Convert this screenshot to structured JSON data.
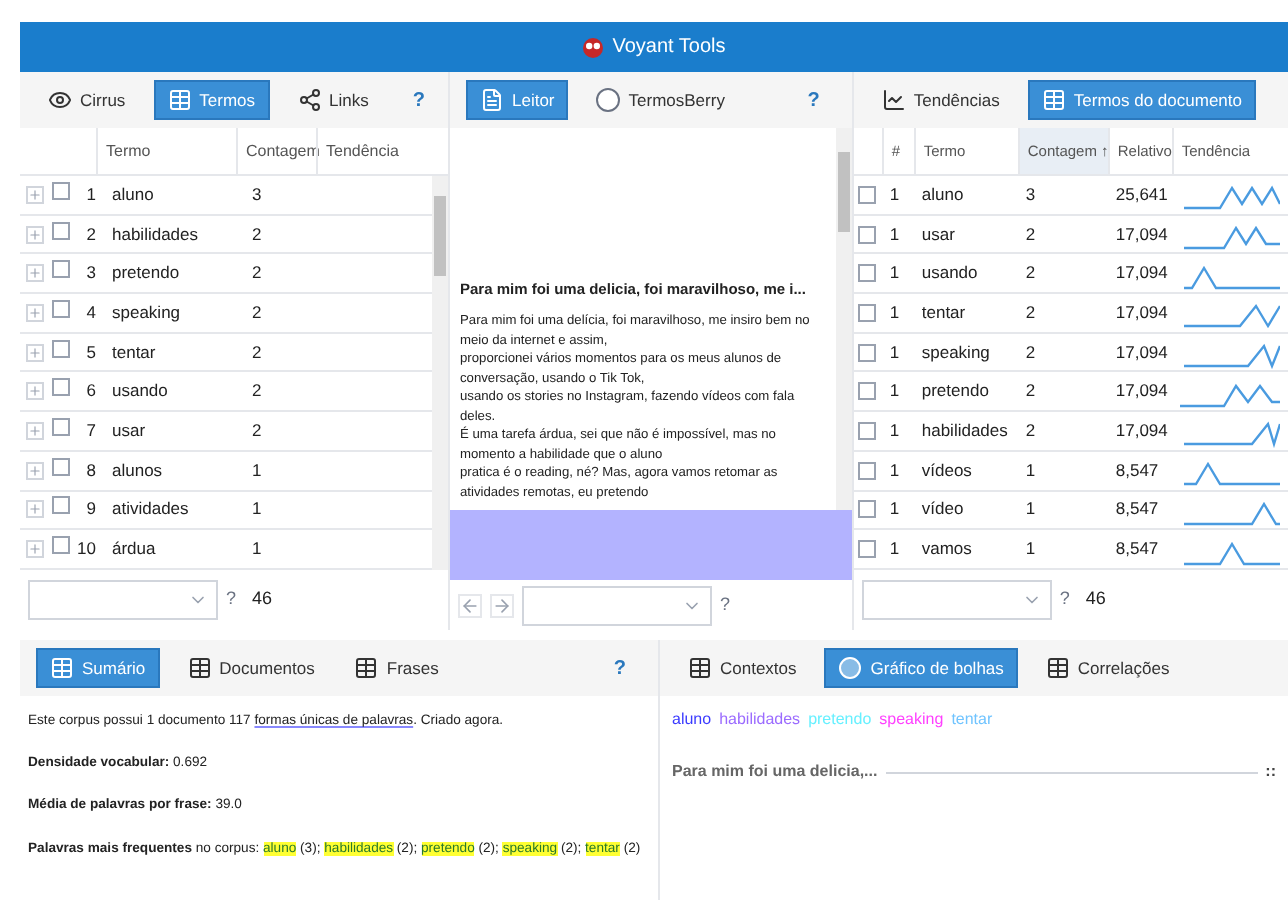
{
  "header": {
    "title": "Voyant Tools"
  },
  "terms_panel": {
    "tabs": [
      {
        "label": "Cirrus",
        "kind": "eye",
        "selected": false
      },
      {
        "label": "Termos",
        "kind": "table",
        "selected": true
      },
      {
        "label": "Links",
        "kind": "links",
        "selected": false
      }
    ],
    "help": "?",
    "columns": [
      "Termo",
      "Contagem",
      "Tendência"
    ],
    "rows": [
      {
        "num": "1",
        "term": "aluno",
        "count": "3",
        "checked": false
      },
      {
        "num": "2",
        "term": "habilidades",
        "count": "2",
        "checked": false
      },
      {
        "num": "3",
        "term": "pretendo",
        "count": "2",
        "checked": false
      },
      {
        "num": "4",
        "term": "speaking",
        "count": "2",
        "checked": false
      },
      {
        "num": "5",
        "term": "tentar",
        "count": "2",
        "checked": false
      },
      {
        "num": "6",
        "term": "usando",
        "count": "2",
        "checked": false
      },
      {
        "num": "7",
        "term": "usar",
        "count": "2",
        "checked": false
      },
      {
        "num": "8",
        "term": "alunos",
        "count": "1",
        "checked": false
      },
      {
        "num": "9",
        "term": "atividades",
        "count": "1",
        "checked": false
      },
      {
        "num": "10",
        "term": "árdua",
        "count": "1",
        "checked": false
      }
    ],
    "footer": {
      "help": "?",
      "total": "46"
    }
  },
  "reader_panel": {
    "tabs": [
      {
        "label": "Leitor",
        "kind": "doc",
        "selected": true
      },
      {
        "label": "TermosBerry",
        "kind": "radio",
        "selected": false
      }
    ],
    "help": "?",
    "title": "Para mim foi uma delicia, foi maravilhoso, me i...",
    "lines": [
      "Para mim foi uma delícia, foi maravilhoso, me insiro bem no meio da internet e assim,",
      "proporcionei vários momentos para os meus alunos de conversação, usando o Tik Tok,",
      "usando os stories no Instagram, fazendo vídeos com fala deles.",
      "É uma tarefa árdua, sei que não é impossível, mas no momento a habilidade que o aluno",
      "pratica é o reading, né? Mas, agora vamos retomar as atividades remotas, eu pretendo"
    ],
    "footer": {
      "help": "?"
    }
  },
  "doc_terms_panel": {
    "tabs": [
      {
        "label": "Tendências",
        "kind": "chart",
        "selected": false
      },
      {
        "label": "Termos do documento",
        "kind": "table",
        "selected": true
      }
    ],
    "columns": [
      {
        "label": "#",
        "sorted": false
      },
      {
        "label": "Termo",
        "sorted": false
      },
      {
        "label": "Contagem ↑",
        "sorted": true
      },
      {
        "label": "Relativo",
        "sorted": false
      },
      {
        "label": "Tendência",
        "sorted": false
      }
    ],
    "rows": [
      {
        "num": "1",
        "term": "aluno",
        "count": "3",
        "relative": "25,641",
        "checked": false
      },
      {
        "num": "1",
        "term": "usar",
        "count": "2",
        "relative": "17,094",
        "checked": false
      },
      {
        "num": "1",
        "term": "usando",
        "count": "2",
        "relative": "17,094",
        "checked": false
      },
      {
        "num": "1",
        "term": "tentar",
        "count": "2",
        "relative": "17,094",
        "checked": false
      },
      {
        "num": "1",
        "term": "speaking",
        "count": "2",
        "relative": "17,094",
        "checked": false
      },
      {
        "num": "1",
        "term": "pretendo",
        "count": "2",
        "relative": "17,094",
        "checked": false
      },
      {
        "num": "1",
        "term": "habilidades",
        "count": "2",
        "relative": "17,094",
        "checked": false
      },
      {
        "num": "1",
        "term": "vídeos",
        "count": "1",
        "relative": "8,547",
        "checked": false
      },
      {
        "num": "1",
        "term": "vídeo",
        "count": "1",
        "relative": "8,547",
        "checked": false
      },
      {
        "num": "1",
        "term": "vamos",
        "count": "1",
        "relative": "8,547",
        "checked": false
      }
    ],
    "footer": {
      "help": "?",
      "total": "46"
    }
  },
  "summary_panel": {
    "tabs": [
      {
        "label": "Sumário",
        "kind": "table",
        "selected": true
      },
      {
        "label": "Documentos",
        "kind": "table",
        "selected": false
      },
      {
        "label": "Frases",
        "kind": "table",
        "selected": false
      }
    ],
    "help": "?",
    "corpus_line": {
      "before": "Este corpus possui 1 documento 117 ",
      "link": "formas únicas de palavras",
      "after": ". Criado agora."
    },
    "density": {
      "label": "Densidade vocabular:",
      "value": "0.692"
    },
    "average": {
      "label": "Média de palavras por frase:",
      "value": "39.0"
    },
    "frequent": {
      "label": "Palavras mais frequentes",
      "suffix": "no corpus:",
      "items": [
        {
          "term": "aluno",
          "count": "(3);"
        },
        {
          "term": "habilidades",
          "count": "(2);"
        },
        {
          "term": "pretendo",
          "count": "(2);"
        },
        {
          "term": "speaking",
          "count": "(2);"
        },
        {
          "term": "tentar",
          "count": "(2)"
        }
      ]
    }
  },
  "bubbles_panel": {
    "tabs": [
      {
        "label": "Contextos",
        "kind": "table",
        "selected": false
      },
      {
        "label": "Gráfico de bolhas",
        "kind": "bubble",
        "selected": true
      },
      {
        "label": "Correlações",
        "kind": "table",
        "selected": false
      }
    ],
    "legend": [
      {
        "term": "aluno",
        "color": "#3b3bff"
      },
      {
        "term": "habilidades",
        "color": "#9b6bff"
      },
      {
        "term": "pretendo",
        "color": "#66f0ff"
      },
      {
        "term": "speaking",
        "color": "#ff40ff"
      },
      {
        "term": "tentar",
        "color": "#70c4ff"
      }
    ],
    "document": {
      "label": "Para mim foi uma delicia,...",
      "handle": "::"
    }
  }
}
